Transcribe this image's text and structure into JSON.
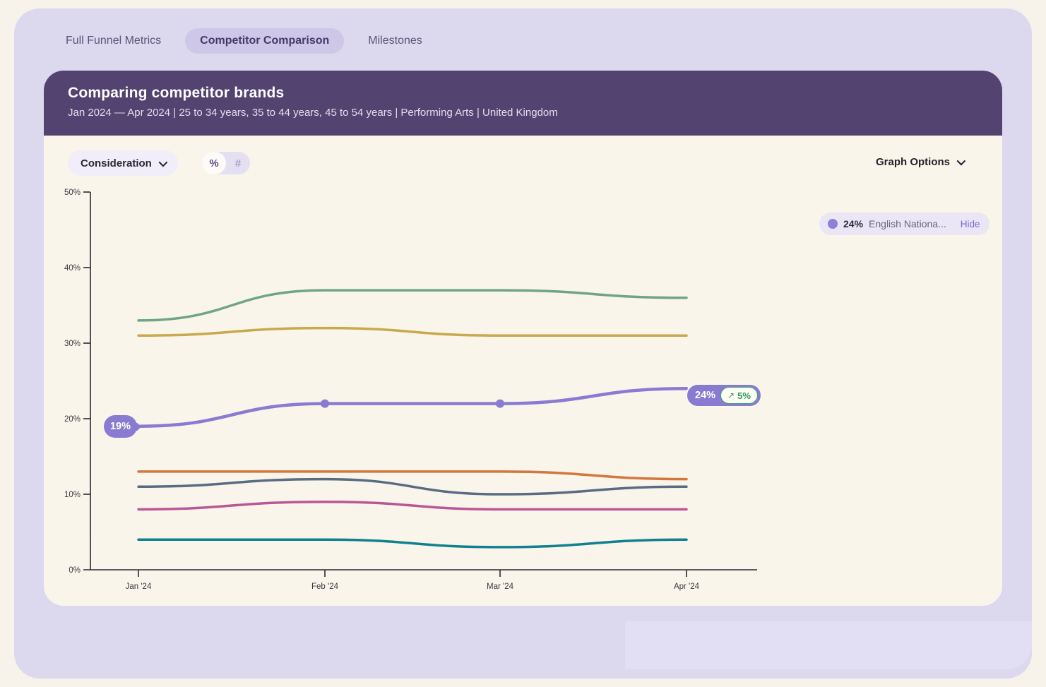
{
  "tabs": [
    {
      "label": "Full Funnel Metrics",
      "active": false
    },
    {
      "label": "Competitor Comparison",
      "active": true
    },
    {
      "label": "Milestones",
      "active": false
    }
  ],
  "header": {
    "title": "Comparing competitor brands",
    "subtitle": "Jan 2024 — Apr 2024 | 25 to 34 years, 35 to 44 years, 45 to 54 years | Performing Arts | United Kingdom"
  },
  "controls": {
    "metric_dropdown_value": "Consideration",
    "unit_percent": "%",
    "unit_count": "#",
    "unit_selected": "%",
    "graph_options_label": "Graph Options"
  },
  "legend": {
    "value": "24%",
    "name": "English Nationa...",
    "hide_label": "Hide",
    "dot_color": "#8F7FD6"
  },
  "annotations": {
    "start_label": "19%",
    "end_value": "24%",
    "end_delta_arrow": "↗",
    "end_delta": "5%"
  },
  "chart_data": {
    "type": "line",
    "x": [
      "Jan '24",
      "Feb '24",
      "Mar '24",
      "Apr '24"
    ],
    "yticks": [
      "0%",
      "10%",
      "20%",
      "30%",
      "40%",
      "50%"
    ],
    "ylim": [
      0,
      50
    ],
    "grid": false,
    "legend_position": "right",
    "metric": "Consideration",
    "unit": "%",
    "series": [
      {
        "name": "green-series",
        "color": "#6FA583",
        "values": [
          33,
          37,
          37,
          36
        ],
        "highlighted": false
      },
      {
        "name": "yellow-series",
        "color": "#C9A94C",
        "values": [
          31,
          32,
          31,
          31
        ],
        "highlighted": false
      },
      {
        "name": "English Nationa...",
        "color": "#8A7BD2",
        "values": [
          19,
          22,
          22,
          24
        ],
        "highlighted": true
      },
      {
        "name": "orange-series",
        "color": "#D4763E",
        "values": [
          13,
          13,
          13,
          12
        ],
        "highlighted": false
      },
      {
        "name": "slate-series",
        "color": "#5A6B84",
        "values": [
          11,
          12,
          10,
          11
        ],
        "highlighted": false
      },
      {
        "name": "magenta-series",
        "color": "#BC5795",
        "values": [
          8,
          9,
          8,
          8
        ],
        "highlighted": false
      },
      {
        "name": "teal-series",
        "color": "#11808F",
        "values": [
          4,
          4,
          3,
          4
        ],
        "highlighted": false
      }
    ],
    "axis_color": "#2D2833",
    "tick_label_color": "#3A3642"
  }
}
